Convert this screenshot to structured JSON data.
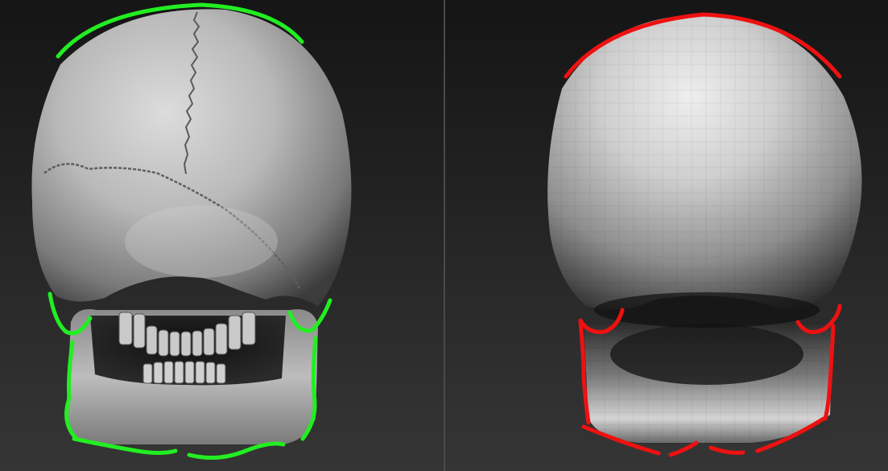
{
  "colors": {
    "background": "#2a2a2a",
    "divider": "#4a4a4a",
    "good_outline": "#22ee22",
    "bad_outline": "#ee1111",
    "skull_light": "#d8d8d8",
    "skull_dark": "#3a3a3a"
  },
  "panels": [
    {
      "id": "detailed-skull",
      "outline_color": "good_outline"
    },
    {
      "id": "blockout-skull",
      "outline_color": "bad_outline"
    }
  ]
}
